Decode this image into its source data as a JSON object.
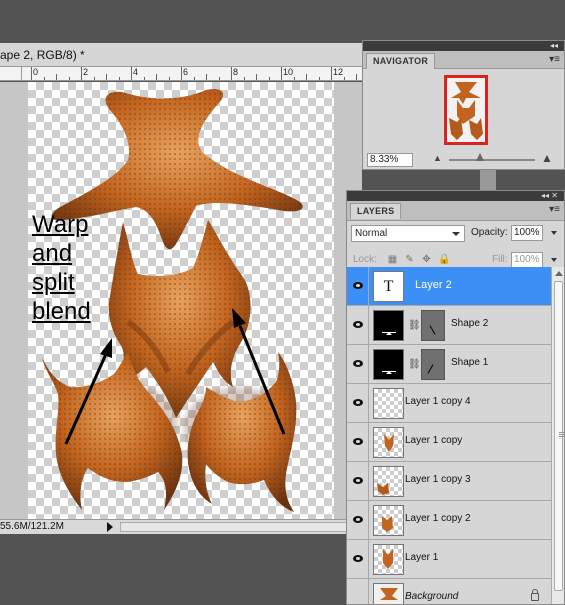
{
  "document": {
    "title": "ape 2, RGB/8) *",
    "ruler_numbers": [
      "0",
      "2",
      "4",
      "6",
      "8",
      "10",
      "12"
    ],
    "canvas_text": [
      "Warp",
      "and",
      "split",
      "blend"
    ],
    "status_text": "55.6M/121.2M"
  },
  "navigator": {
    "title": "NAVIGATOR",
    "zoom": "8.33%",
    "menu_icon": "panel-menu-icon",
    "thumbnail_border_color": "#d22222"
  },
  "layers_panel": {
    "title": "LAYERS",
    "blend_mode": "Normal",
    "opacity_label": "Opacity:",
    "opacity_value": "100%",
    "lock_label": "Lock:",
    "fill_label": "Fill:",
    "fill_value": "100%",
    "layers": [
      {
        "name": "Layer 2",
        "kind": "text",
        "selected": true,
        "visible": true
      },
      {
        "name": "Shape 2",
        "kind": "shape",
        "selected": false,
        "visible": true
      },
      {
        "name": "Shape 1",
        "kind": "shape",
        "selected": false,
        "visible": true
      },
      {
        "name": "Layer 1 copy 4",
        "kind": "pixel",
        "selected": false,
        "visible": true
      },
      {
        "name": "Layer 1 copy",
        "kind": "pixel",
        "selected": false,
        "visible": true
      },
      {
        "name": "Layer 1 copy 3",
        "kind": "pixel",
        "selected": false,
        "visible": true
      },
      {
        "name": "Layer 1 copy 2",
        "kind": "pixel",
        "selected": false,
        "visible": true
      },
      {
        "name": "Layer 1",
        "kind": "pixel",
        "selected": false,
        "visible": true
      },
      {
        "name": "Background",
        "kind": "background",
        "selected": false,
        "visible": false
      }
    ],
    "selection_color": "#3b8ff5"
  },
  "colors": {
    "starfish_main": "#c86a26",
    "starfish_dark": "#7a3a12",
    "starfish_light": "#e3a05a",
    "workspace": "#535353"
  }
}
